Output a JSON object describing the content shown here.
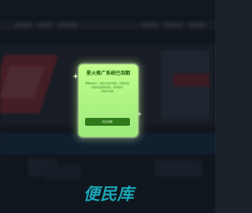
{
  "popup": {
    "title": "星火推广系统已到期",
    "body_lines": [
      "尊敬的用户，您的系统已到期，如需使用，",
      "请续费后继续使用，若有疑问，",
      "请联系客服。"
    ],
    "button_label": "前往续费"
  },
  "logo": {
    "text": "便民库"
  },
  "colors": {
    "popup_bg": "#b7f889",
    "popup_title": "#1e5f10",
    "popup_body": "#3e8a30",
    "button_bg": "#2f7a1a",
    "logo": "#1aa6b8"
  }
}
